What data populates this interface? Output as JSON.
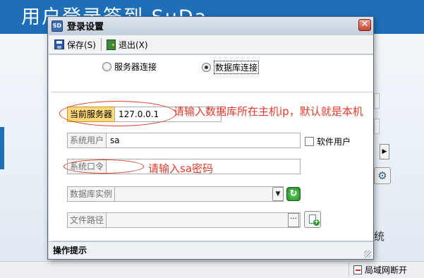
{
  "background": {
    "title": "用户登录签到 SuDa",
    "extra_text": "统",
    "status_network": "局域网断开"
  },
  "dialog": {
    "title": "登录设置",
    "icon_text": "SD",
    "close_glyph": "✕",
    "toolbar": {
      "save_label": "保存(S)",
      "exit_label": "退出(X)"
    },
    "connection": {
      "options": [
        "服务器连接",
        "数据库连接"
      ],
      "selected": "数据库连接"
    },
    "fields": {
      "server_label": "当前服务器",
      "server_value": "127.0.0.1",
      "user_label": "系统用户",
      "user_value": "sa",
      "software_user_label": "软件用户",
      "password_label": "系统口令",
      "password_value": "",
      "db_instance_label": "数据库实例",
      "db_instance_value": "",
      "file_path_label": "文件路径",
      "file_path_value": ""
    },
    "footer_label": "操作提示"
  },
  "annotations": {
    "server_note": "请输入数据库所在主机ip，默认就是本机",
    "password_note": "请输入sa密码",
    "color": "#e03a2a"
  },
  "icons": {
    "save": "save-icon",
    "exit": "exit-icon",
    "refresh": "refresh-icon",
    "dropdown": "chevron-down-icon",
    "browse": "ellipsis-icon",
    "add_file": "add-file-icon"
  }
}
